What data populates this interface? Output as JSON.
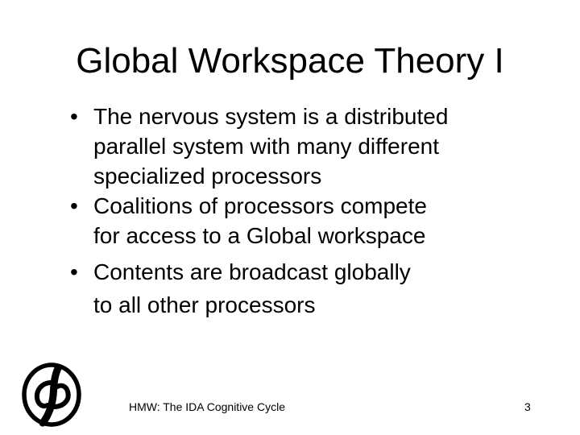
{
  "slide": {
    "title": "Global Workspace Theory I",
    "bullet_symbol": "•",
    "bullets": [
      {
        "lines": [
          "The nervous system is a distributed",
          "parallel system with many different",
          "specialized processors"
        ]
      },
      {
        "lines": [
          "Coalitions of processors compete",
          "for access to a Global workspace"
        ]
      },
      {
        "lines": [
          "Contents are broadcast globally",
          "to all other processors"
        ]
      }
    ],
    "footer_text": "HMW: The IDA Cognitive Cycle",
    "page_number": "3",
    "logo_icon": "university-of-memphis-logo-icon"
  }
}
